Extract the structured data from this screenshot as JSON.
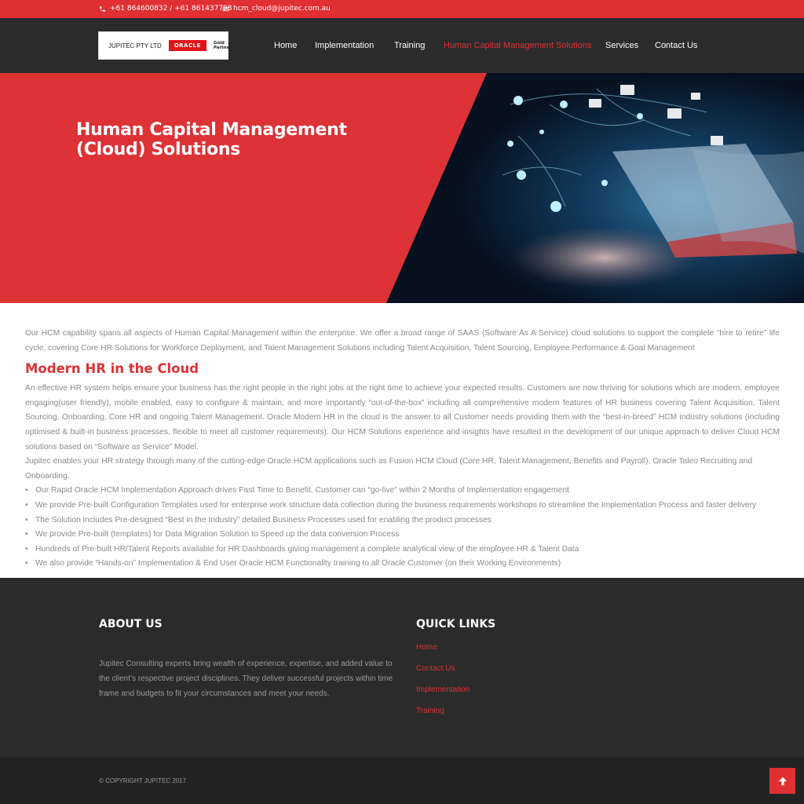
{
  "topbar": {
    "phone": "+61 864600832 / +61 861437798",
    "email": "hcm_cloud@jupitec.com.au",
    "phone_icon": "phone-icon",
    "email_icon": "envelope-icon"
  },
  "logo": {
    "company": "JUPITEC PTY LTD",
    "oracle": "ORACLE",
    "partner_line1": "Gold",
    "partner_line2": "Partner"
  },
  "nav": {
    "items": [
      {
        "label": "Home",
        "active": false
      },
      {
        "label": "Implementation",
        "active": false
      },
      {
        "label": "Training",
        "active": false
      },
      {
        "label": "Human Capital Management Solutions",
        "active": true
      },
      {
        "label": "Services",
        "active": false
      },
      {
        "label": "Contact Us",
        "active": false
      }
    ]
  },
  "hero": {
    "title_line1": "Human Capital Management",
    "title_line2": "(Cloud) Solutions"
  },
  "content": {
    "intro": "Our HCM capability spans all aspects of Human Capital Management within the enterprise. We offer a broad range of SAAS (Software As A Service) cloud solutions to support the complete “hire to retire” life cycle, covering Core HR Solutions for Workforce Deployment, and Talent Management Solutions including Talent Acquisition, Talent Sourcing, Employee Performance & Goal Management",
    "heading": "Modern HR in the Cloud",
    "para1": "An effective HR system helps ensure your business has the right people in the right jobs at the right time to achieve your expected results. Customers are now thriving for solutions which are modern, employee engaging(user friendly), mobile enabled, easy to configure & maintain, and more importantly “out-of-the-box” including all comprehensive modern features of HR business covering Talent Acquisition, Talent Sourcing, Onboarding, Core HR and ongoing Talent Management. Oracle Modern HR in the cloud is the answer to all Customer needs providing them with the “best-in-breed” HCM industry solutions (including optimised & built-in business processes, flexible to meet all customer requirements). Our HCM Solutions experience and insights have resulted in the development of our unique approach to deliver Cloud HCM solutions based on “Software as Service” Model.",
    "para2": "Jupitec enables your HR strategy through many of the cutting-edge Oracle HCM applications such as Fusion HCM Cloud (Core HR, Talent Management, Benefits and Payroll), Oracle Taleo Recruiting and Onboarding,",
    "bullets": [
      "Our Rapid Oracle HCM Implementation Approach drives Fast Time to Benefit. Customer can “go-live” within 2 Months of Implementation engagement",
      "We provide Pre-built Configuration Templates used for enterprise work structure data collection during the business requirements workshops to streamline the Implementation Process and faster delivery",
      "The Solution includes Pre-designed “Best in the Industry” detailed Business Processes used for enabling the product processes",
      "We provide Pre-built (templates) for Data Migration Solution to Speed up the data conversion Process",
      "Hundreds of Pre-built HR/Talent Reports available for HR Dashboards giving management a complete analytical view of the employee HR & Talent Data",
      "We also provide “Hands-on” Implementation & End User Oracle HCM Functionality training to all Oracle Customer (on their Working Environments)"
    ]
  },
  "footer": {
    "about_title": "ABOUT US",
    "about_text": "Jupitec Consulting experts bring wealth of experience, expertise, and added value to the client’s respective project disciplines. They deliver successful projects within time frame and budgets to fit your circumstances and meet your needs.",
    "links_title": "QUICK LINKS",
    "links": [
      "Home",
      "Contact Us",
      "Implementation",
      "Training"
    ],
    "copyright": "© COPYRIGHT JUPITEC 2017"
  },
  "colors": {
    "accent": "#e03033",
    "dark": "#2b2b2b",
    "text_gray": "#8a8a8a"
  }
}
